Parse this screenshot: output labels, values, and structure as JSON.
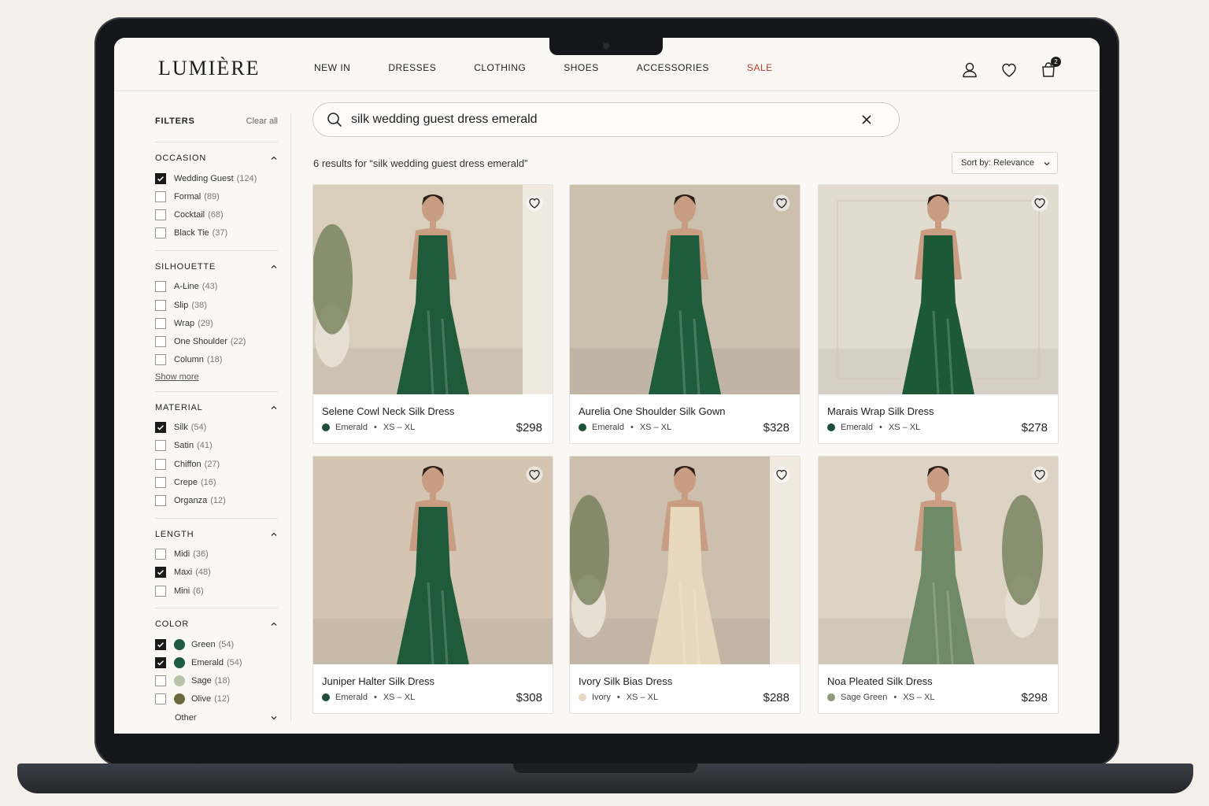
{
  "header": {
    "logo": "LUMIÈRE",
    "nav": [
      "NEW IN",
      "DRESSES",
      "CLOTHING",
      "SHOES",
      "ACCESSORIES",
      "SALE"
    ],
    "cart_count": "2",
    "icons": [
      "user-icon",
      "heart-icon",
      "shopping-bag-icon"
    ]
  },
  "filters": {
    "title": "FILTERS",
    "clear_all": "Clear all",
    "occasion": {
      "title": "OCCASION",
      "options": [
        {
          "label": "Wedding Guest",
          "count": "(124)",
          "checked": true
        },
        {
          "label": "Formal",
          "count": "(89)",
          "checked": false
        },
        {
          "label": "Cocktail",
          "count": "(68)",
          "checked": false
        },
        {
          "label": "Black Tie",
          "count": "(37)",
          "checked": false
        }
      ]
    },
    "silhouette": {
      "title": "SILHOUETTE",
      "options": [
        {
          "label": "A-Line",
          "count": "(43)",
          "checked": false
        },
        {
          "label": "Slip",
          "count": "(38)",
          "checked": false
        },
        {
          "label": "Wrap",
          "count": "(29)",
          "checked": false
        },
        {
          "label": "One Shoulder",
          "count": "(22)",
          "checked": false
        },
        {
          "label": "Column",
          "count": "(18)",
          "checked": false
        }
      ],
      "show_more": "Show more"
    },
    "material": {
      "title": "MATERIAL",
      "options": [
        {
          "label": "Silk",
          "count": "(54)",
          "checked": true
        },
        {
          "label": "Satin",
          "count": "(41)",
          "checked": false
        },
        {
          "label": "Chiffon",
          "count": "(27)",
          "checked": false
        },
        {
          "label": "Crepe",
          "count": "(16)",
          "checked": false
        },
        {
          "label": "Organza",
          "count": "(12)",
          "checked": false
        }
      ]
    },
    "length": {
      "title": "LENGTH",
      "options": [
        {
          "label": "Midi",
          "count": "(36)",
          "checked": false
        },
        {
          "label": "Maxi",
          "count": "(48)",
          "checked": true
        },
        {
          "label": "Mini",
          "count": "(6)",
          "checked": false
        }
      ]
    },
    "color": {
      "title": "COLOR",
      "options": [
        {
          "label": "Green",
          "count": "(54)",
          "checked": true,
          "swatch": "#1f5a3e"
        },
        {
          "label": "Emerald",
          "count": "(54)",
          "checked": true,
          "swatch": "#1e5a42"
        },
        {
          "label": "Sage",
          "count": "(18)",
          "checked": false,
          "swatch": "#b6c3a8"
        },
        {
          "label": "Olive",
          "count": "(12)",
          "checked": false,
          "swatch": "#6b6a3a"
        }
      ],
      "other": "Other"
    }
  },
  "search": {
    "value": "silk wedding guest dress emerald",
    "results_text": "6 results for “silk wedding guest dress emerald”",
    "sort_label": "Sort by: Relevance"
  },
  "products": [
    {
      "name": "Selene Cowl Neck Silk Dress",
      "color": "Emerald",
      "sizes": "XS – XL",
      "price": "$298",
      "dot": "#1f4f36",
      "dress": "#1f5a3b",
      "bg": "#d9cdbb"
    },
    {
      "name": "Aurelia One Shoulder Silk Gown",
      "color": "Emerald",
      "sizes": "XS – XL",
      "price": "$328",
      "dot": "#1f4f36",
      "dress": "#1e5c3c",
      "bg": "#cbbfae"
    },
    {
      "name": "Marais Wrap Silk Dress",
      "color": "Emerald",
      "sizes": "XS – XL",
      "price": "$278",
      "dot": "#1f4f36",
      "dress": "#1d5937",
      "bg": "#e2dbd0"
    },
    {
      "name": "Juniper Halter Silk Dress",
      "color": "Emerald",
      "sizes": "XS – XL",
      "price": "$308",
      "dot": "#1f4f36",
      "dress": "#1f5a3b",
      "bg": "#d3c5b1"
    },
    {
      "name": "Ivory Silk Bias Dress",
      "color": "Ivory",
      "sizes": "XS – XL",
      "price": "$288",
      "dot": "#e6d9c4",
      "dress": "#e8d8bd",
      "bg": "#cdbfae"
    },
    {
      "name": "Noa Pleated Silk Dress",
      "color": "Sage Green",
      "sizes": "XS – XL",
      "price": "$298",
      "dot": "#8a9a78",
      "dress": "#6f8a66",
      "bg": "#ddd3c5"
    }
  ]
}
